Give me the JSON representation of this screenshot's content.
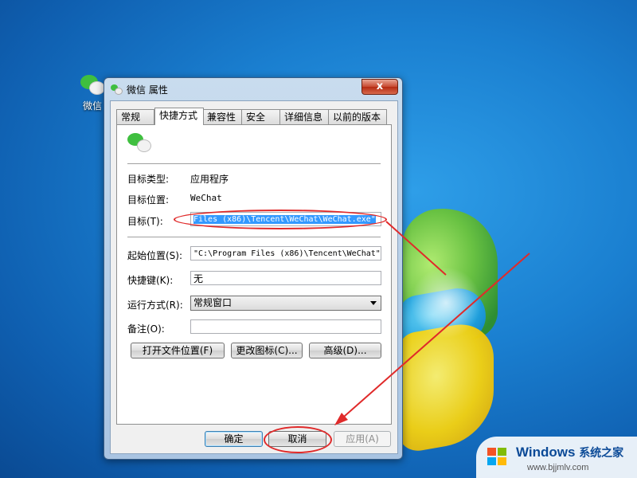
{
  "desktop": {
    "icon_label": "微信"
  },
  "window": {
    "title": "微信 属性",
    "close_glyph": "x",
    "tabs": [
      {
        "label": "常规"
      },
      {
        "label": "快捷方式"
      },
      {
        "label": "兼容性"
      },
      {
        "label": "安全"
      },
      {
        "label": "详细信息"
      },
      {
        "label": "以前的版本"
      }
    ],
    "active_tab": "快捷方式",
    "props": {
      "target_type_label": "目标类型:",
      "target_type_value": "应用程序",
      "target_location_label": "目标位置:",
      "target_location_value": "WeChat",
      "target_label": "目标(T):",
      "target_value": " Files (x86)\\Tencent\\WeChat\\WeChat.exe\"",
      "start_in_label": "起始位置(S):",
      "start_in_value": "\"C:\\Program Files (x86)\\Tencent\\WeChat\"",
      "shortcut_key_label": "快捷键(K):",
      "shortcut_key_value": "无",
      "run_label": "运行方式(R):",
      "run_value": "常规窗口",
      "comment_label": "备注(O):",
      "comment_value": ""
    },
    "buttons": {
      "open_location": "打开文件位置(F)",
      "change_icon": "更改图标(C)...",
      "advanced": "高级(D)...",
      "ok": "确定",
      "cancel": "取消",
      "apply": "应用(A)"
    }
  },
  "watermark": {
    "brand": "Windows",
    "brand_cn": "系统之家",
    "url": "www.bjjmlv.com"
  },
  "colors": {
    "annotation_red": "#e02a2a",
    "selection_blue": "#3399ff"
  }
}
